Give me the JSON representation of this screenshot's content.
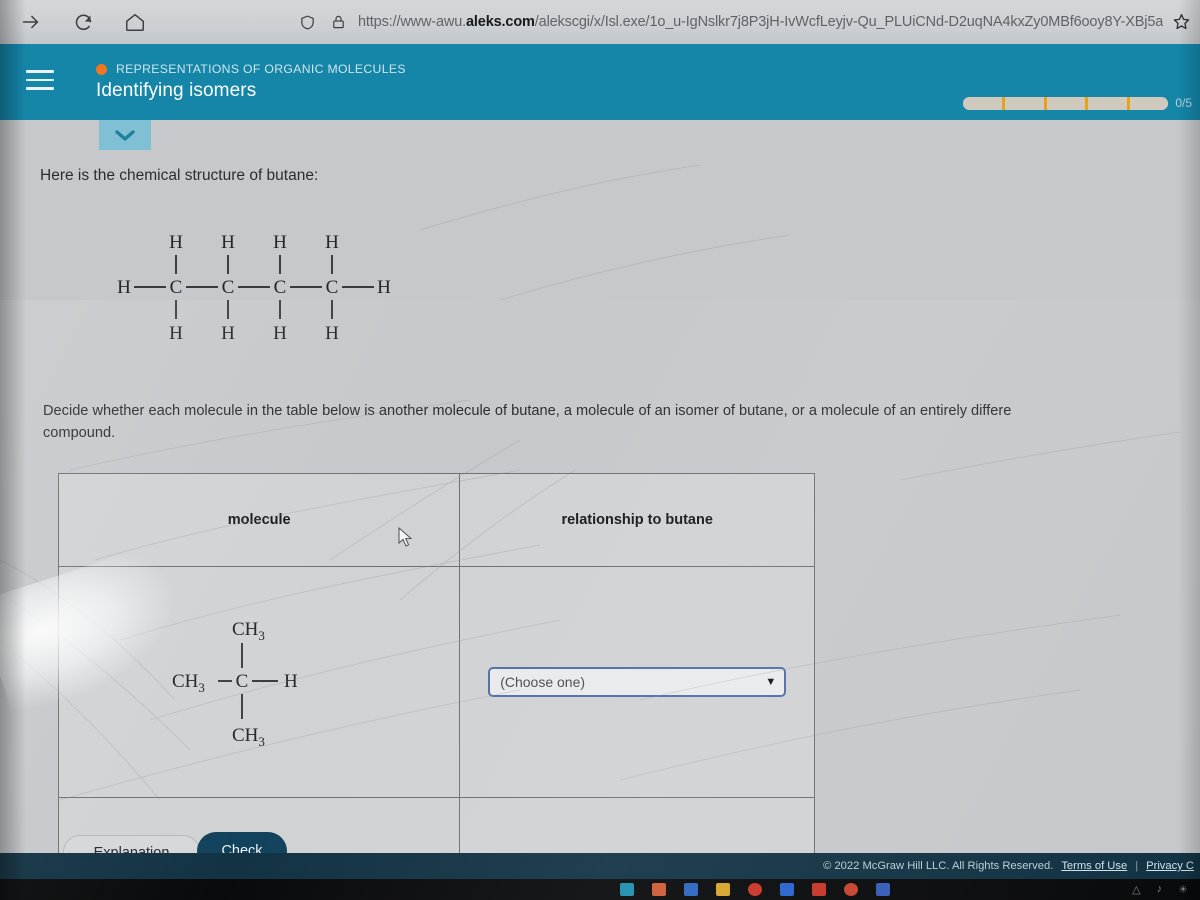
{
  "browser": {
    "forward_icon": "forward-arrow-icon",
    "reload_icon": "reload-icon",
    "home_icon": "home-icon",
    "shield_icon": "shield-icon",
    "lock_icon": "lock-icon",
    "bookmark_icon": "star-icon",
    "url_scheme": "https://www-awu.",
    "url_domain": "aleks.com",
    "url_path": "/alekscgi/x/Isl.exe/1o_u-IgNslkr7j8P3jH-IvWcfLeyjv-Qu_PLUiCNd-D2uqNA4kxZy0MBf6ooy8Y-XBj5a"
  },
  "header": {
    "menu_icon": "hamburger-menu-icon",
    "topic_dot_color": "#ef7622",
    "topic": "REPRESENTATIONS OF ORGANIC MOLECULES",
    "title": "Identifying isomers",
    "progress_segments": 5,
    "progress_label": "0/5",
    "bar_color": "#1585a8"
  },
  "content": {
    "collapse_tab_icon": "chevron-down-icon",
    "intro": "Here is the chemical structure of butane:",
    "prompt_line1": "Decide whether each molecule in the table below is another molecule of butane, a molecule of an isomer of butane, or a molecule of an entirely differe",
    "prompt_line2": "compound."
  },
  "butane_structure": {
    "top_hydrogens": [
      "H",
      "H",
      "H",
      "H"
    ],
    "left_hydrogen": "H",
    "carbons": [
      "C",
      "C",
      "C",
      "C"
    ],
    "right_hydrogen": "H",
    "bottom_hydrogens": [
      "H",
      "H",
      "H",
      "H"
    ]
  },
  "table": {
    "headers": {
      "molecule": "molecule",
      "relationship": "relationship to butane"
    },
    "rows": [
      {
        "molecule": {
          "top": "CH",
          "top_sub": "3",
          "left": "CH",
          "left_sub": "3",
          "center": "C",
          "right": "H",
          "bottom": "CH",
          "bottom_sub": "3"
        },
        "dropdown_value": "(Choose one)",
        "dropdown_caret": "caret-down-icon"
      }
    ]
  },
  "buttons": {
    "explanation": "Explanation",
    "check": "Check"
  },
  "footer": {
    "copyright": "© 2022 McGraw Hill LLC. All Rights Reserved.",
    "terms": "Terms of Use",
    "separator": "|",
    "privacy": "Privacy C"
  }
}
